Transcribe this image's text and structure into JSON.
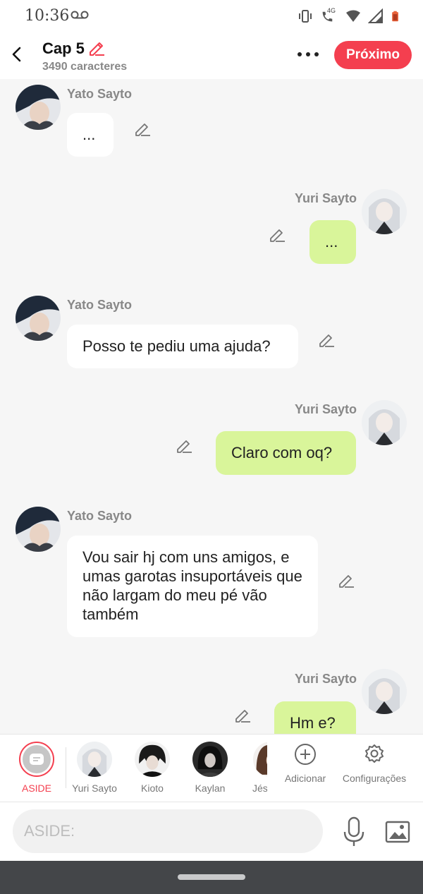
{
  "status_bar": {
    "time": "10:36",
    "network_label": "4G"
  },
  "header": {
    "title": "Cap 5",
    "subtitle": "3490 caracteres",
    "next_button": "Próximo"
  },
  "colors": {
    "accent": "#f43f4f",
    "bubble_right": "#d9f59a",
    "bubble_left": "#ffffff",
    "background": "#f6f6f6"
  },
  "messages": [
    {
      "sender": "Yato Sayto",
      "side": "left",
      "text": "..."
    },
    {
      "sender": "Yuri Sayto",
      "side": "right",
      "text": "..."
    },
    {
      "sender": "Yato Sayto",
      "side": "left",
      "text": "Posso te pediu uma ajuda?"
    },
    {
      "sender": "Yuri Sayto",
      "side": "right",
      "text": "Claro com oq?"
    },
    {
      "sender": "Yato Sayto",
      "side": "left",
      "text": "Vou sair hj com uns amigos, e umas garotas insuportáveis que não largam do meu pé vão também"
    },
    {
      "sender": "Yuri Sayto",
      "side": "right",
      "text": "Hm e?"
    }
  ],
  "character_bar": {
    "items": [
      {
        "label": "ASIDE"
      },
      {
        "label": "Yuri Sayto"
      },
      {
        "label": "Kioto"
      },
      {
        "label": "Kaylan"
      },
      {
        "label": "Jés"
      }
    ],
    "add_label": "Adicionar",
    "settings_label": "Configurações"
  },
  "input": {
    "placeholder": "ASIDE:",
    "value": ""
  },
  "icons": {
    "back": "chevron-left-icon",
    "more": "more-dots-icon",
    "edit": "pencil-icon",
    "mic": "microphone-icon",
    "image": "image-icon",
    "add": "plus-circle-icon",
    "settings": "gear-icon"
  }
}
